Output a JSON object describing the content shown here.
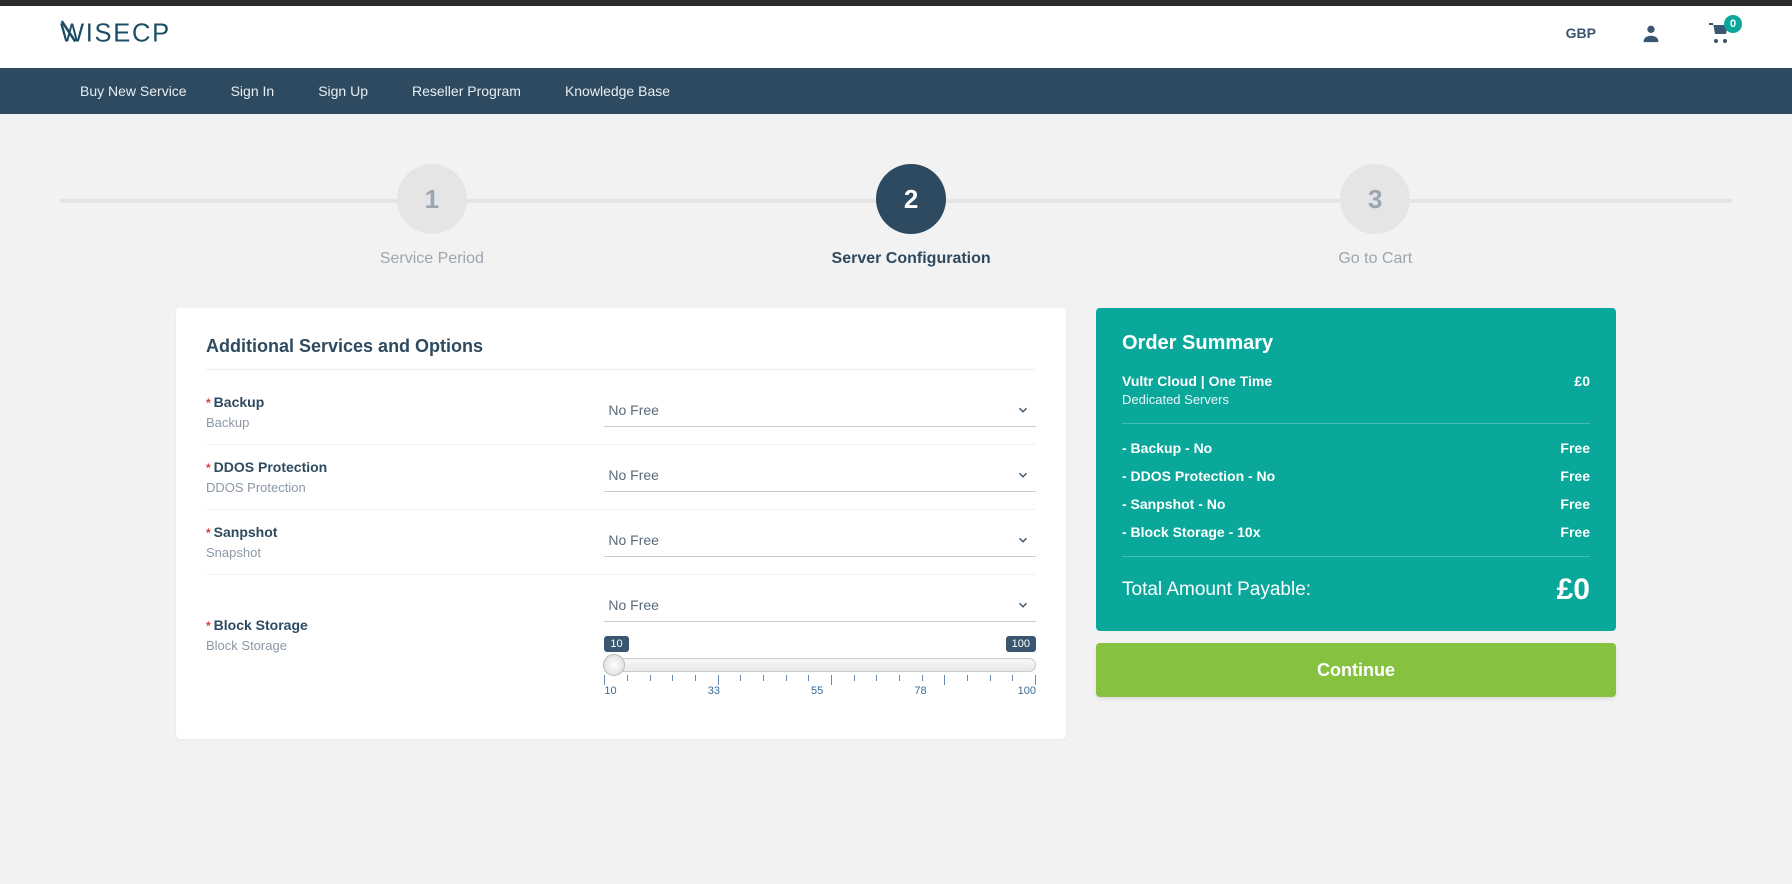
{
  "header": {
    "currency": "GBP",
    "cart_count": "0"
  },
  "nav": {
    "items": [
      "Buy New Service",
      "Sign In",
      "Sign Up",
      "Reseller Program",
      "Knowledge Base"
    ]
  },
  "steps": {
    "s1": {
      "num": "1",
      "label": "Service Period"
    },
    "s2": {
      "num": "2",
      "label": "Server Configuration"
    },
    "s3": {
      "num": "3",
      "label": "Go to Cart"
    }
  },
  "panel": {
    "title": "Additional Services and Options",
    "options": {
      "backup": {
        "title": "Backup",
        "desc": "Backup",
        "value": "No Free"
      },
      "ddos": {
        "title": "DDOS Protection",
        "desc": "DDOS Protection",
        "value": "No Free"
      },
      "snap": {
        "title": "Sanpshot",
        "desc": "Snapshot",
        "value": "No Free"
      },
      "block": {
        "title": "Block Storage",
        "desc": "Block Storage",
        "value": "No Free",
        "min": "10",
        "max": "100",
        "ticks": [
          "10",
          "33",
          "55",
          "78",
          "100"
        ]
      }
    }
  },
  "summary": {
    "title": "Order Summary",
    "product": "Vultr Cloud | One Time",
    "product_price": "£0",
    "category": "Dedicated Servers",
    "items": [
      {
        "l": "- Backup - No",
        "r": "Free"
      },
      {
        "l": "- DDOS Protection - No",
        "r": "Free"
      },
      {
        "l": "- Sanpshot - No",
        "r": "Free"
      },
      {
        "l": "- Block Storage - 10x",
        "r": "Free"
      }
    ],
    "total_label": "Total Amount Payable:",
    "total_value": "£0",
    "continue": "Continue"
  }
}
